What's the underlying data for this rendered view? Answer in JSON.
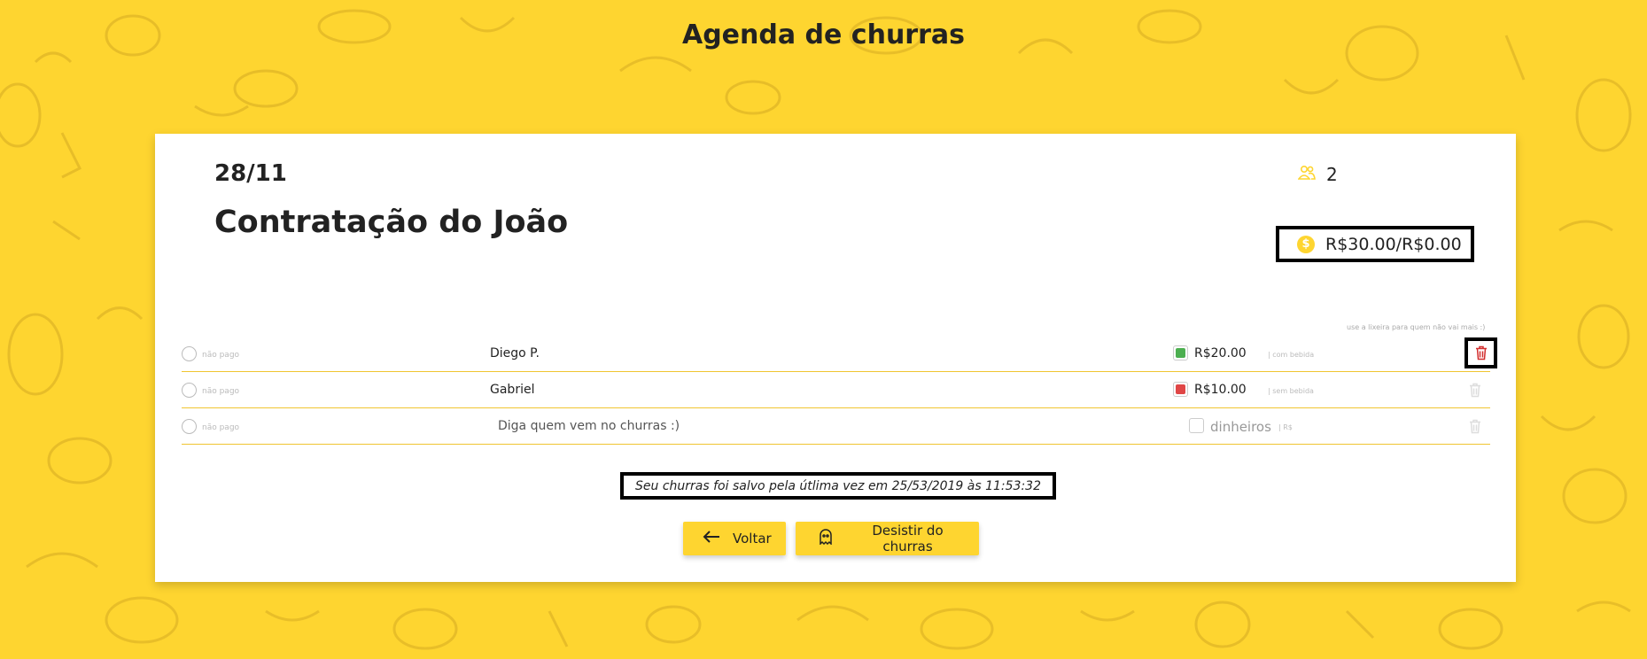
{
  "header": {
    "title": "Agenda de churras"
  },
  "event": {
    "date": "28/11",
    "title": "Contratação do João",
    "people_count": "2",
    "money_summary": "R$30.00/R$0.00",
    "trash_hint": "use a lixeira para quem não vai mais :)"
  },
  "participants": [
    {
      "paid_label": "não pago",
      "name": "Diego P.",
      "amount": "R$20.00",
      "drink_label": "| com bebida",
      "drink": true,
      "drink_color": "#4caf50"
    },
    {
      "paid_label": "não pago",
      "name": "Gabriel",
      "amount": "R$10.00",
      "drink_label": "| sem bebida",
      "drink": false,
      "drink_color": "#e04646"
    }
  ],
  "new_participant": {
    "paid_label": "não pago",
    "name_placeholder": "Diga quem vem no churras :)",
    "amount_placeholder": "dinheiros",
    "currency_label": "| R$"
  },
  "saved_message": "Seu churras foi salvo pela útlima vez em 25/53/2019 às 11:53:32",
  "buttons": {
    "back": "Voltar",
    "quit": "Desistir do churras"
  },
  "icons": {
    "people": "people-icon",
    "money": "dollar-coin-icon",
    "trash": "trash-icon",
    "back": "arrow-left-icon",
    "quit": "ghost-icon"
  },
  "colors": {
    "background": "#fed530",
    "accent": "#fed530",
    "trash_active": "#d32f2f"
  }
}
